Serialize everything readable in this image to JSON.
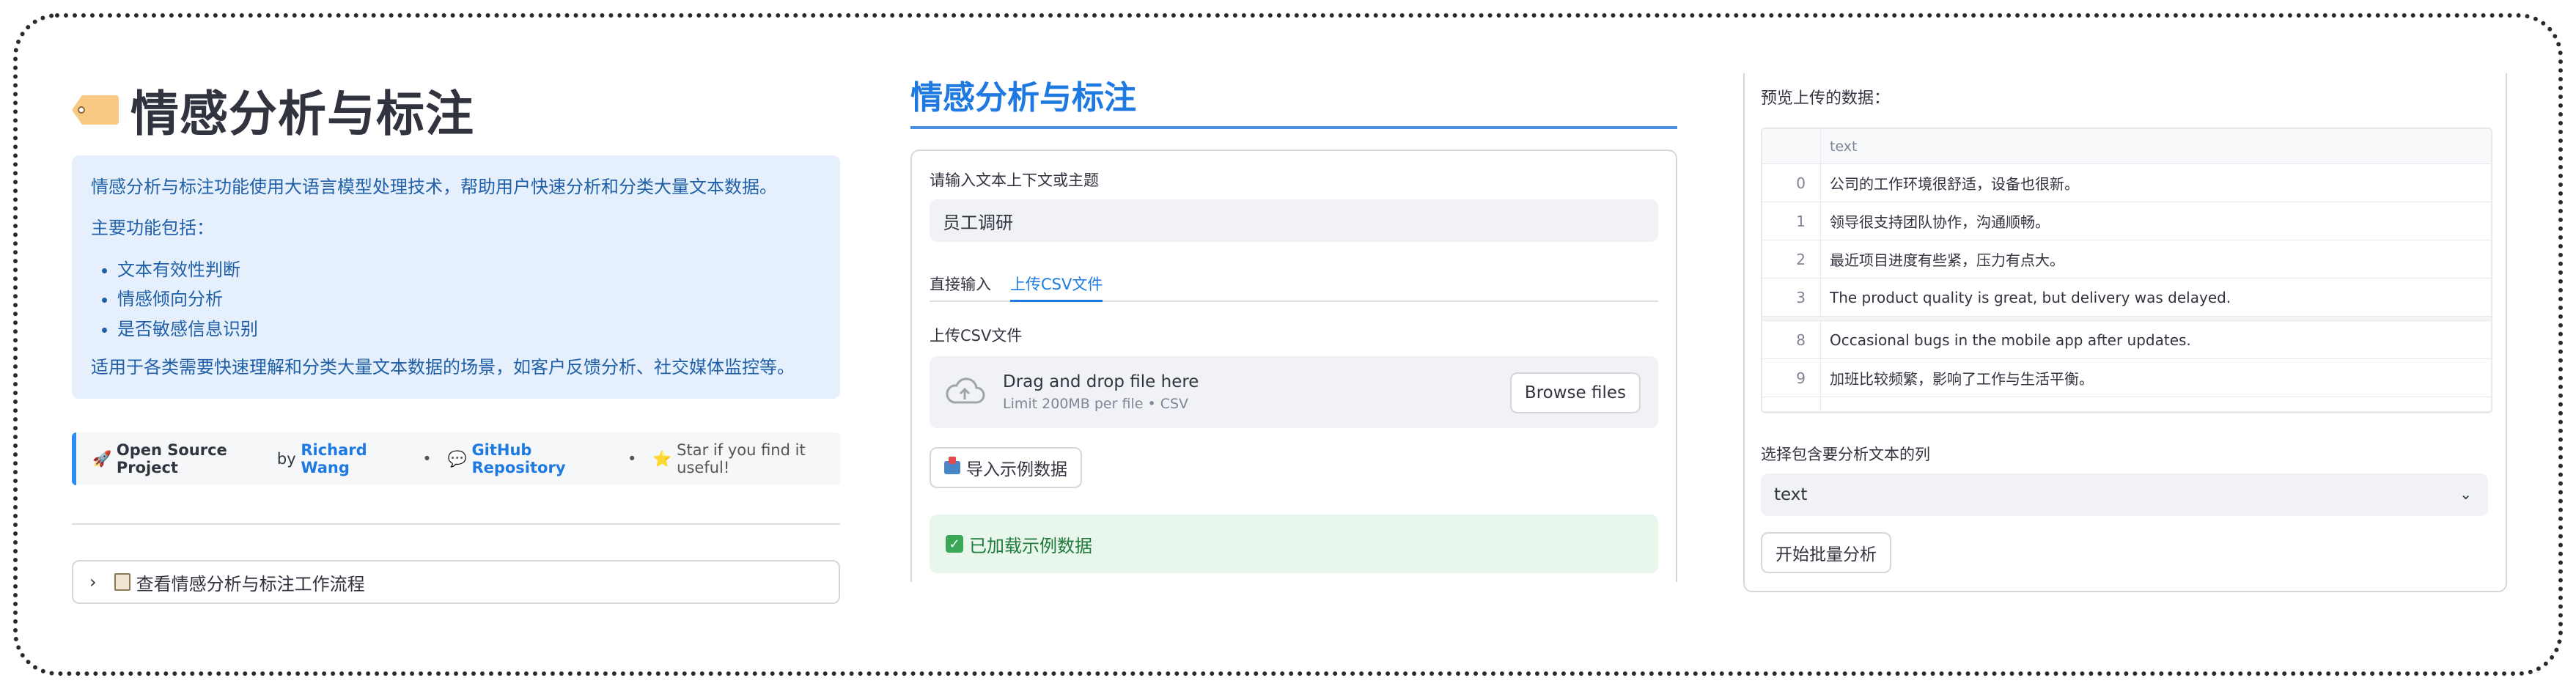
{
  "left": {
    "title": "情感分析与标注",
    "info": {
      "intro": "情感分析与标注功能使用大语言模型处理技术，帮助用户快速分析和分类大量文本数据。",
      "features_heading": "主要功能包括：",
      "features": [
        "文本有效性判断",
        "情感倾向分析",
        "是否敏感信息识别"
      ],
      "usage": "适用于各类需要快速理解和分类大量文本数据的场景，如客户反馈分析、社交媒体监控等。"
    },
    "credit": {
      "rocket": "🚀",
      "open_source": "Open Source Project",
      "by": "by",
      "author": "Richard Wang",
      "separator": "•",
      "github_icon": "💬",
      "github": "GitHub Repository",
      "star_icon": "⭐",
      "star_text": "Star if you find it useful!"
    },
    "expander": {
      "chevron": "›",
      "label": "查看情感分析与标注工作流程"
    }
  },
  "middle": {
    "title": "情感分析与标注",
    "context_label": "请输入文本上下文或主题",
    "context_value": "员工调研",
    "tabs": [
      "直接输入",
      "上传CSV文件"
    ],
    "active_tab": 1,
    "upload_label": "上传CSV文件",
    "dropzone": {
      "main": "Drag and drop file here",
      "sub": "Limit 200MB per file • CSV",
      "browse": "Browse files"
    },
    "import_button": "导入示例数据",
    "success_check": "✓",
    "success_message": "已加载示例数据"
  },
  "right": {
    "preview_title": "预览上传的数据：",
    "table": {
      "header": "text",
      "rows": [
        {
          "idx": "0",
          "text": "公司的工作环境很舒适，设备也很新。"
        },
        {
          "idx": "1",
          "text": "领导很支持团队协作，沟通顺畅。"
        },
        {
          "idx": "2",
          "text": "最近项目进度有些紧，压力有点大。"
        },
        {
          "idx": "3",
          "text": "The product quality is great, but delivery was delayed."
        }
      ],
      "rows_after": [
        {
          "idx": "8",
          "text": "Occasional bugs in the mobile app after updates."
        },
        {
          "idx": "9",
          "text": "加班比较频繁，影响了工作与生活平衡。"
        }
      ]
    },
    "column_select_label": "选择包含要分析文本的列",
    "column_select_value": "text",
    "start_button": "开始批量分析"
  }
}
